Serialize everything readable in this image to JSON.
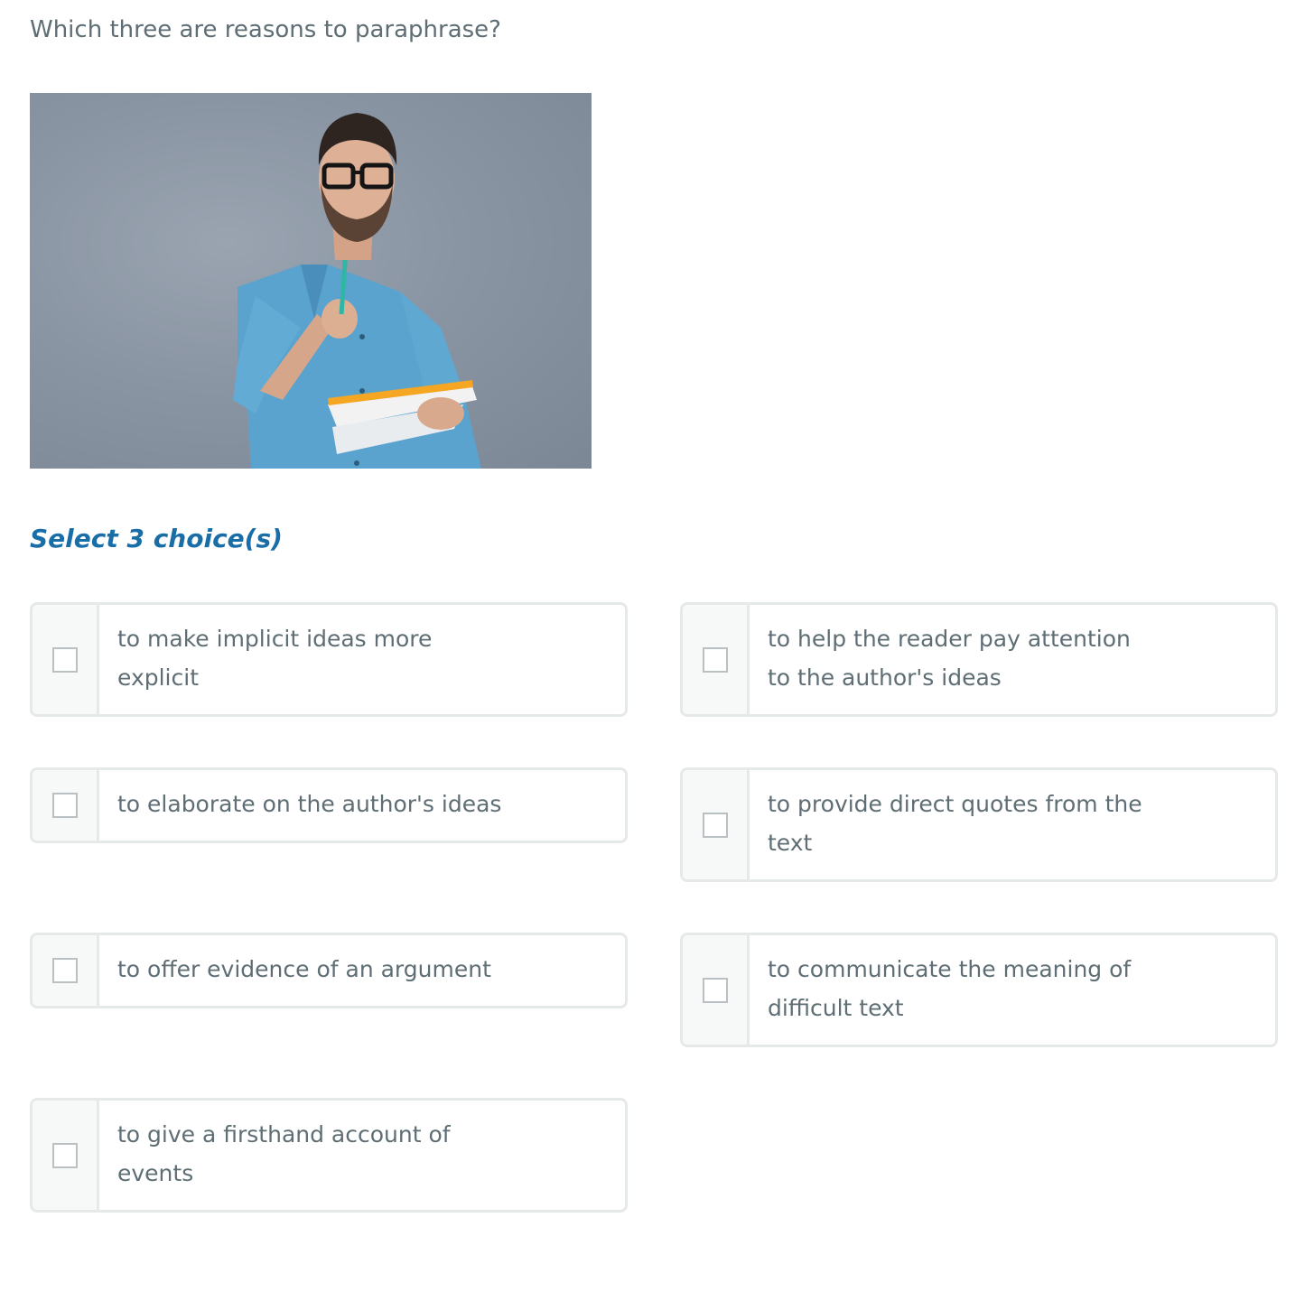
{
  "question": {
    "text": "Which three are reasons to paraphrase?"
  },
  "image": {
    "description_icon": "thinking-man-photo"
  },
  "instruction": {
    "text": "Select 3 choice(s)"
  },
  "choices": [
    {
      "label": "to make implicit ideas more explicit",
      "checked": false
    },
    {
      "label": "to help the reader pay attention to the author's ideas",
      "checked": false
    },
    {
      "label": "to elaborate on the author's ideas",
      "checked": false
    },
    {
      "label": "to provide direct quotes from the text",
      "checked": false
    },
    {
      "label": "to offer evidence of an argument",
      "checked": false
    },
    {
      "label": "to communicate the meaning of difficult text",
      "checked": false
    },
    {
      "label": "to give a firsthand account of events",
      "checked": false
    }
  ],
  "colors": {
    "accent": "#1a6ea8",
    "text": "#5e6e74",
    "border": "#e6e9ea"
  }
}
